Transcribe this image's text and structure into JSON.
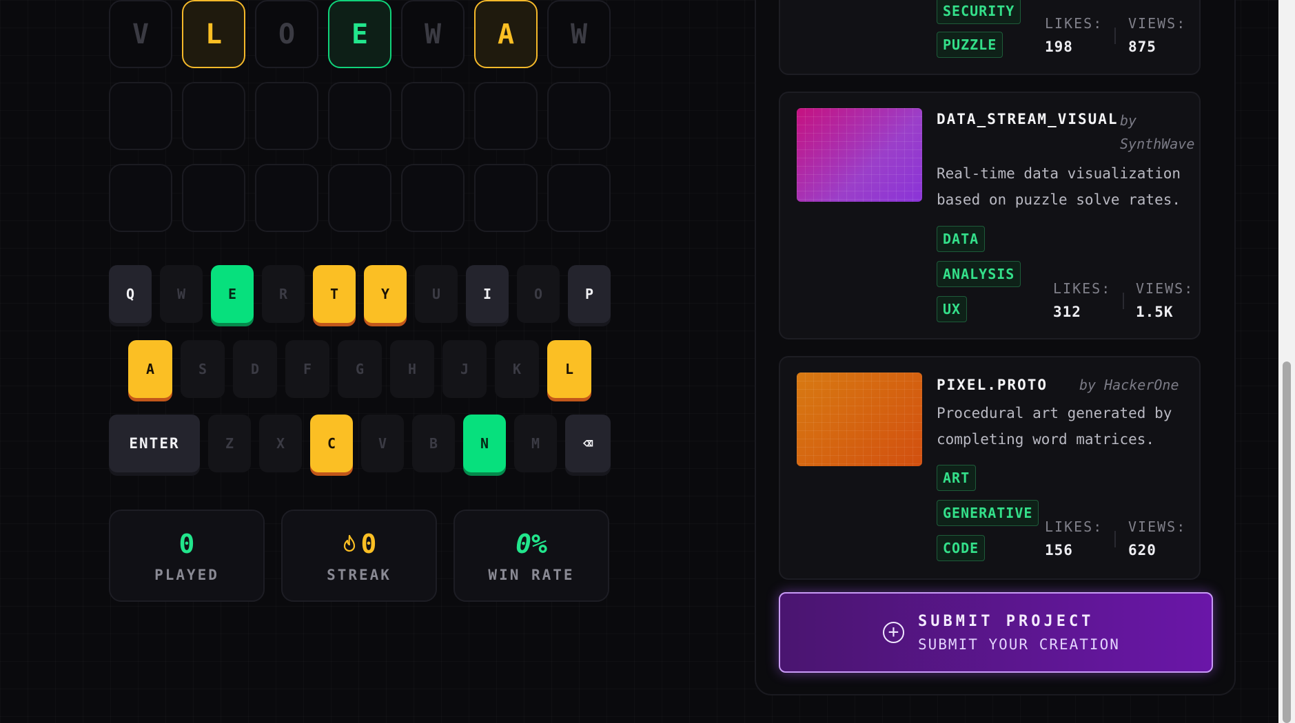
{
  "board": {
    "rows": [
      [
        {
          "letter": "V",
          "state": "absent"
        },
        {
          "letter": "L",
          "state": "present"
        },
        {
          "letter": "O",
          "state": "absent"
        },
        {
          "letter": "E",
          "state": "correct"
        },
        {
          "letter": "W",
          "state": "absent"
        },
        {
          "letter": "A",
          "state": "present"
        },
        {
          "letter": "W",
          "state": "absent"
        }
      ],
      [
        {
          "letter": "",
          "state": "empty"
        },
        {
          "letter": "",
          "state": "empty"
        },
        {
          "letter": "",
          "state": "empty"
        },
        {
          "letter": "",
          "state": "empty"
        },
        {
          "letter": "",
          "state": "empty"
        },
        {
          "letter": "",
          "state": "empty"
        },
        {
          "letter": "",
          "state": "empty"
        }
      ],
      [
        {
          "letter": "",
          "state": "empty"
        },
        {
          "letter": "",
          "state": "empty"
        },
        {
          "letter": "",
          "state": "empty"
        },
        {
          "letter": "",
          "state": "empty"
        },
        {
          "letter": "",
          "state": "empty"
        },
        {
          "letter": "",
          "state": "empty"
        },
        {
          "letter": "",
          "state": "empty"
        }
      ]
    ]
  },
  "keyboard": {
    "row1": [
      {
        "k": "Q",
        "s": "unused"
      },
      {
        "k": "W",
        "s": "absent"
      },
      {
        "k": "E",
        "s": "correct"
      },
      {
        "k": "R",
        "s": "absent"
      },
      {
        "k": "T",
        "s": "present"
      },
      {
        "k": "Y",
        "s": "present"
      },
      {
        "k": "U",
        "s": "absent"
      },
      {
        "k": "I",
        "s": "unused"
      },
      {
        "k": "O",
        "s": "absent"
      },
      {
        "k": "P",
        "s": "unused"
      }
    ],
    "row2": [
      {
        "k": "A",
        "s": "present"
      },
      {
        "k": "S",
        "s": "absent"
      },
      {
        "k": "D",
        "s": "absent"
      },
      {
        "k": "F",
        "s": "absent"
      },
      {
        "k": "G",
        "s": "absent"
      },
      {
        "k": "H",
        "s": "absent"
      },
      {
        "k": "J",
        "s": "absent"
      },
      {
        "k": "K",
        "s": "absent"
      },
      {
        "k": "L",
        "s": "present"
      }
    ],
    "row3": [
      {
        "k": "ENTER",
        "s": "unused"
      },
      {
        "k": "Z",
        "s": "absent"
      },
      {
        "k": "X",
        "s": "absent"
      },
      {
        "k": "C",
        "s": "present"
      },
      {
        "k": "V",
        "s": "absent"
      },
      {
        "k": "B",
        "s": "absent"
      },
      {
        "k": "N",
        "s": "correct"
      },
      {
        "k": "M",
        "s": "absent"
      },
      {
        "k": "⌫",
        "s": "unused"
      }
    ],
    "colors": {
      "present": "#fbbf24",
      "correct": "#07e07d"
    }
  },
  "stats": {
    "played": {
      "value": "0",
      "label": "PLAYED",
      "color": "#22e58c"
    },
    "streak": {
      "value": "0",
      "label": "STREAK",
      "color": "#fbbf24",
      "icon": "flame-icon"
    },
    "win_rate": {
      "value": "0%",
      "label": "WIN RATE",
      "color": "#22e58c"
    }
  },
  "projects": [
    {
      "tags": [
        "SECURITY",
        "PUZZLE"
      ],
      "likes_label": "LIKES:",
      "likes": "198",
      "views_label": "VIEWS:",
      "views": "875"
    },
    {
      "title": "DATA_STREAM_VISUAL",
      "by": "by",
      "author": "SynthWave",
      "desc": "Real-time data visualization based on puzzle solve rates.",
      "tags": [
        "DATA",
        "ANALYSIS",
        "UX"
      ],
      "likes_label": "LIKES:",
      "likes": "312",
      "views_label": "VIEWS:",
      "views": "1.5K",
      "thumb": "magenta-grid"
    },
    {
      "title": "PIXEL.PROTO",
      "author_line": "by HackerOne",
      "desc": "Procedural art generated by completing word matrices.",
      "tags": [
        "ART",
        "GENERATIVE",
        "CODE"
      ],
      "likes_label": "LIKES:",
      "likes": "156",
      "views_label": "VIEWS:",
      "views": "620",
      "thumb": "orange-grid"
    }
  ],
  "submit": {
    "title": "SUBMIT PROJECT",
    "subtitle": "SUBMIT YOUR CREATION",
    "icon": "plus-circle-icon"
  }
}
